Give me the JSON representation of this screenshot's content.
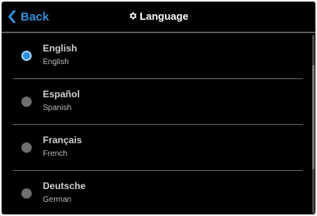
{
  "header": {
    "back_label": "Back",
    "title": "Language",
    "back_icon": "chevron-left-icon",
    "title_icon": "gear-icon"
  },
  "languages": [
    {
      "name": "English",
      "translation": "English",
      "selected": true
    },
    {
      "name": "Español",
      "translation": "Spanish",
      "selected": false
    },
    {
      "name": "Français",
      "translation": "French",
      "selected": false
    },
    {
      "name": "Deutsche",
      "translation": "German",
      "selected": false
    }
  ],
  "colors": {
    "accent": "#2f8fd8",
    "background": "#000000",
    "unselected_radio": "#6f6f6f"
  }
}
